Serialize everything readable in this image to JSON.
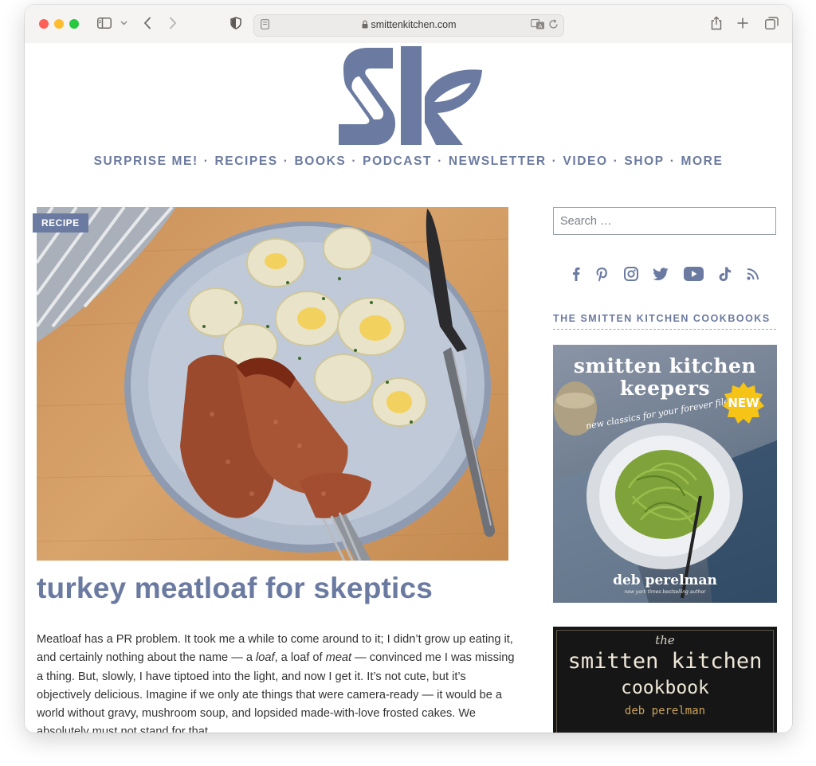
{
  "browser": {
    "url_host": "smittenkitchen.com",
    "traffic_colors": {
      "close": "#fe5f57",
      "minimize": "#febc2e",
      "zoom": "#28c840"
    }
  },
  "brand": {
    "logo_text": "sk",
    "accent_color": "#6b7aa0"
  },
  "nav": {
    "items": [
      "SURPRISE ME!",
      "RECIPES",
      "BOOKS",
      "PODCAST",
      "NEWSLETTER",
      "VIDEO",
      "SHOP",
      "MORE"
    ],
    "separator": "·"
  },
  "post": {
    "badge": "RECIPE",
    "title": "turkey meatloaf for skeptics",
    "body_p1": "Meatloaf has a PR problem. It took me a while to come around to it; I didn’t grow up eating it, and certainly nothing about the name — a ",
    "body_em1": "loaf",
    "body_p2": ", a loaf of ",
    "body_em2": "meat",
    "body_p3": " — convinced me I was missing a thing. But, slowly, I have tiptoed into the light, and now I get it. It’s not cute, but it’s objectively delicious. Imagine if we only ate things that were camera-ready — it would be a world without gravy, mushroom soup, and lopsided made-with-love frosted cakes. We absolutely must not stand for that."
  },
  "sidebar": {
    "search_placeholder": "Search …",
    "social_icons": [
      "facebook-icon",
      "pinterest-icon",
      "instagram-icon",
      "twitter-icon",
      "youtube-icon",
      "tiktok-icon",
      "rss-icon"
    ],
    "heading": "THE SMITTEN KITCHEN COOKBOOKS",
    "book1": {
      "title_line1": "smitten kitchen",
      "title_line2": "keepers",
      "subtitle": "new classics for your forever files",
      "badge": "NEW",
      "author": "deb perelman",
      "author_tag": "new york times bestselling author"
    },
    "book2": {
      "pre": "the",
      "title": "smitten kitchen",
      "subtitle": "cookbook",
      "author": "deb perelman"
    }
  }
}
